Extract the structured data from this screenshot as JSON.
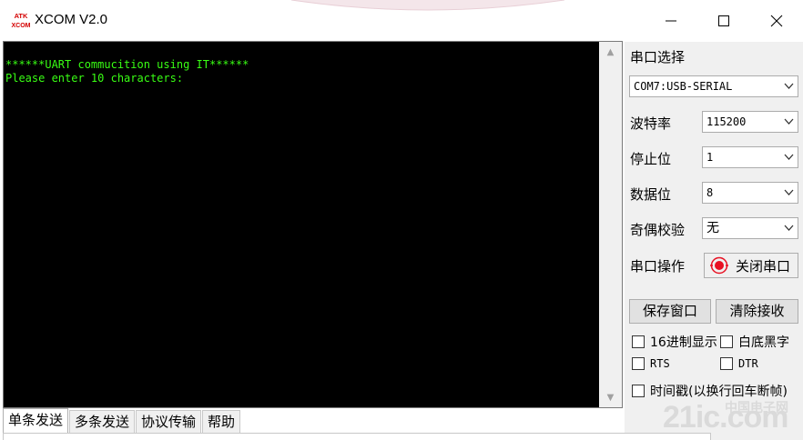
{
  "window": {
    "title": "XCOM V2.0",
    "logo_text_top": "ATK",
    "logo_text_bottom": "XCOM"
  },
  "terminal": {
    "lines": [
      "",
      "******UART commucition using IT******",
      "Please enter 10 characters:"
    ],
    "text_color": "#39ff14",
    "background": "#000000"
  },
  "settings": {
    "port_section_label": "串口选择",
    "port_value": "COM7:USB-SERIAL",
    "baud_label": "波特率",
    "baud_value": "115200",
    "stop_bits_label": "停止位",
    "stop_bits_value": "1",
    "data_bits_label": "数据位",
    "data_bits_value": "8",
    "parity_label": "奇偶校验",
    "parity_value": "无",
    "port_op_label": "串口操作",
    "close_port_button": "关闭串口",
    "led_color": "#e81123"
  },
  "buttons": {
    "save_window": "保存窗口",
    "clear_receive": "清除接收"
  },
  "checkboxes": {
    "hex_display": "16进制显示",
    "white_bg_black_text": "白底黑字",
    "rts": "RTS",
    "dtr": "DTR",
    "timestamp": "时间戳(以换行回车断帧)"
  },
  "tabs": [
    {
      "label": "单条发送",
      "active": true
    },
    {
      "label": "多条发送",
      "active": false
    },
    {
      "label": "协议传输",
      "active": false
    },
    {
      "label": "帮助",
      "active": false
    }
  ],
  "watermark": {
    "domain_text": "21ic.com",
    "cn_text": "中国电子网"
  }
}
